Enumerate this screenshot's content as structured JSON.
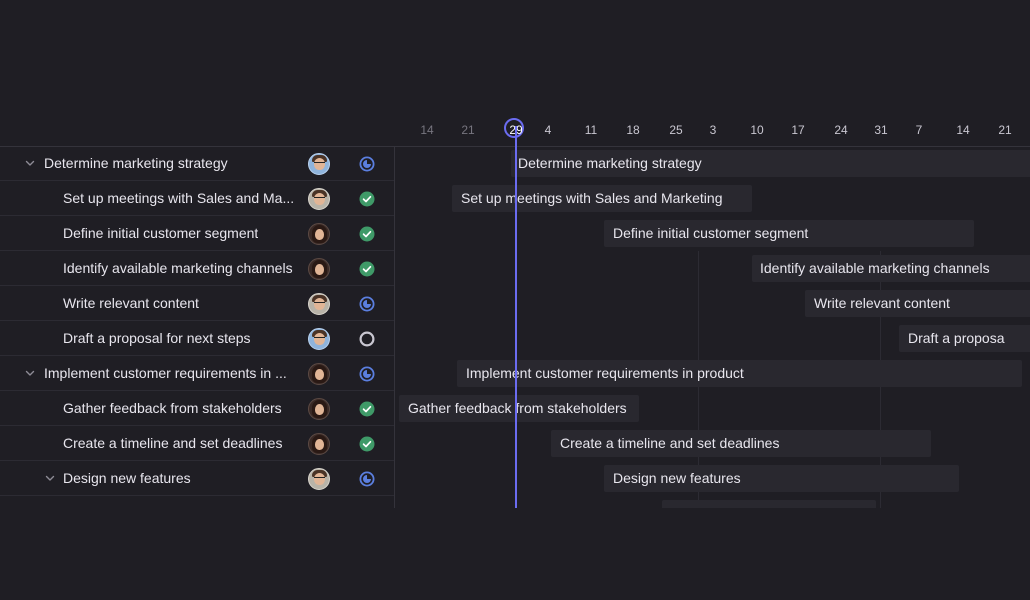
{
  "timeline": {
    "ticks": [
      {
        "label": "14",
        "state": "past"
      },
      {
        "label": "21",
        "state": "past"
      },
      {
        "label": "29",
        "state": "today"
      },
      {
        "label": "4",
        "state": "future"
      },
      {
        "label": "11",
        "state": "future"
      },
      {
        "label": "18",
        "state": "future"
      },
      {
        "label": "25",
        "state": "future"
      },
      {
        "label": "3",
        "state": "future"
      },
      {
        "label": "10",
        "state": "future"
      },
      {
        "label": "17",
        "state": "future"
      },
      {
        "label": "24",
        "state": "future"
      },
      {
        "label": "31",
        "state": "future"
      },
      {
        "label": "7",
        "state": "future"
      },
      {
        "label": "14",
        "state": "future"
      },
      {
        "label": "21",
        "state": "future"
      }
    ]
  },
  "tasks": [
    {
      "name": "Determine marketing strategy",
      "level": 0,
      "collapsible": true,
      "avatar": "person-glasses-blue-bg",
      "status": "in-progress",
      "bar_label": "Determine marketing strategy"
    },
    {
      "name": "Set up meetings with Sales and Ma...",
      "level": 1,
      "collapsible": false,
      "avatar": "person-glasses-grey-bg",
      "status": "done",
      "bar_label": "Set up meetings with Sales and Marketing"
    },
    {
      "name": "Define initial customer segment",
      "level": 1,
      "collapsible": false,
      "avatar": "person-long-hair",
      "status": "done",
      "bar_label": "Define initial customer segment"
    },
    {
      "name": "Identify available marketing channels",
      "level": 1,
      "collapsible": false,
      "avatar": "person-long-hair",
      "status": "done",
      "bar_label": "Identify available marketing channels"
    },
    {
      "name": "Write relevant content",
      "level": 1,
      "collapsible": false,
      "avatar": "person-glasses-grey-bg",
      "status": "in-progress",
      "bar_label": "Write relevant content"
    },
    {
      "name": "Draft a proposal for next steps",
      "level": 1,
      "collapsible": false,
      "avatar": "person-glasses-blue-bg",
      "status": "not-started",
      "bar_label": "Draft a proposa"
    },
    {
      "name": "Implement customer requirements in ...",
      "level": 0,
      "collapsible": true,
      "avatar": "person-short-hair",
      "status": "in-progress",
      "bar_label": "Implement customer requirements in product"
    },
    {
      "name": "Gather feedback from stakeholders",
      "level": 1,
      "collapsible": false,
      "avatar": "person-long-hair",
      "status": "done",
      "bar_label": "Gather feedback from stakeholders"
    },
    {
      "name": "Create a timeline and set deadlines",
      "level": 1,
      "collapsible": false,
      "avatar": "person-long-hair",
      "status": "done",
      "bar_label": "Create a timeline and set deadlines"
    },
    {
      "name": "Design new features",
      "level": 1,
      "collapsible": true,
      "avatar": "person-glasses-grey-bg",
      "status": "in-progress",
      "bar_label": "Design new features"
    }
  ],
  "colors": {
    "background": "#1f1e24",
    "today_accent": "#6b6cf0",
    "status_done": "#3f9a68",
    "status_in_progress": "#5b7fe0",
    "status_not_started": "#c9c7d1",
    "bar": "#29282f"
  },
  "icons": {
    "collapse": "chevron-down-icon",
    "done": "check-circle-icon",
    "in_progress": "clock-circle-icon",
    "not_started": "empty-circle-icon"
  }
}
